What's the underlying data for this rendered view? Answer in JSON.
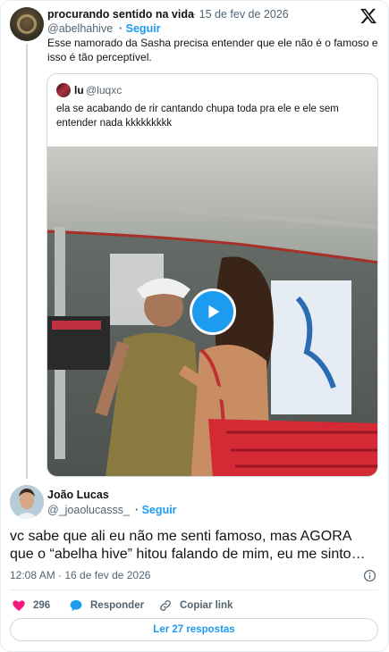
{
  "parent_tweet": {
    "author_name": "procurando sentido na vida",
    "date": "15 de fev de 2026",
    "handle": "@abelhahive",
    "follow_label": "Seguir",
    "text": "Esse namorado da Sasha precisa entender que ele não é o famoso e isso é tão perceptível.",
    "brand_icon": "x-logo-icon"
  },
  "quoted_tweet": {
    "author_name": "lu",
    "handle": "@luqxc",
    "text": "ela se acabando de rir cantando chupa toda pra ele e ele sem entender nada kkkkkkkkk",
    "media": {
      "type": "video",
      "play_icon": "play-icon"
    }
  },
  "reply_tweet": {
    "author_name": "João Lucas",
    "handle": "@_joaolucasss_",
    "follow_label": "Seguir",
    "text": "vc sabe que ali eu não me senti famoso, mas AGORA que o “abelha hive” hitou falando de mim, eu me sinto famoso",
    "timestamp": "12:08 AM · 16 de fev de 2026"
  },
  "actions": {
    "like_count": "296",
    "reply_label": "Responder",
    "copy_label": "Copiar link"
  },
  "read_replies_label": "Ler 27 respostas",
  "colors": {
    "accent": "#1d9bf0",
    "like": "#f91880",
    "text": "#0f1419",
    "muted": "#536471"
  }
}
